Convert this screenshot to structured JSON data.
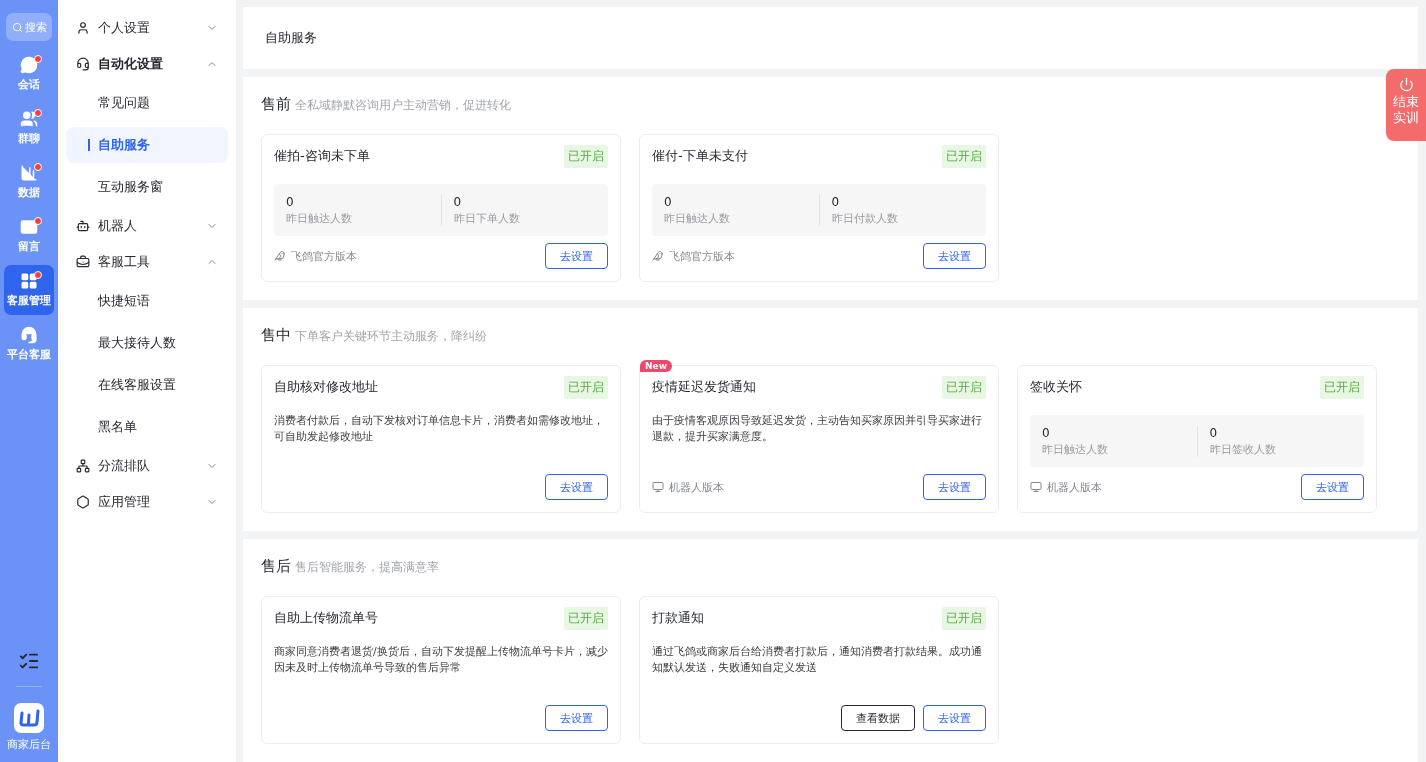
{
  "rail": {
    "search": "搜索",
    "items": [
      {
        "label": "会话",
        "unread": true,
        "selected": false
      },
      {
        "label": "群聊",
        "unread": true,
        "selected": false
      },
      {
        "label": "数据",
        "unread": true,
        "selected": false
      },
      {
        "label": "留言",
        "unread": true,
        "selected": false
      },
      {
        "label": "客服管理",
        "unread": true,
        "selected": true
      },
      {
        "label": "平台客服",
        "unread": false,
        "selected": false
      }
    ],
    "app": "商家后台"
  },
  "menu": [
    {
      "label": "个人设置",
      "expanded": false
    },
    {
      "label": "自动化设置",
      "expanded": true,
      "children": [
        {
          "label": "常见问题",
          "selected": false
        },
        {
          "label": "自助服务",
          "selected": true
        },
        {
          "label": "互动服务窗",
          "selected": false
        }
      ]
    },
    {
      "label": "机器人",
      "expanded": false
    },
    {
      "label": "客服工具",
      "expanded": true,
      "children": [
        {
          "label": "快捷短语",
          "selected": false
        },
        {
          "label": "最大接待人数",
          "selected": false
        },
        {
          "label": "在线客服设置",
          "selected": false
        },
        {
          "label": "黑名单",
          "selected": false
        }
      ]
    },
    {
      "label": "分流排队",
      "expanded": false
    },
    {
      "label": "应用管理",
      "expanded": false
    }
  ],
  "page_title": "自助服务",
  "sections": [
    {
      "title": "售前",
      "subtitle": "全私域静默咨询用户主动营销，促进转化",
      "cards": [
        {
          "title": "催拍-咨询未下单",
          "status": "已开启",
          "stats": [
            {
              "value": "0",
              "label": "昨日触达人数"
            },
            {
              "value": "0",
              "label": "昨日下单人数"
            }
          ],
          "version": {
            "kind": "official",
            "text": "飞鸽官方版本"
          },
          "buttons": [
            {
              "label": "去设置",
              "kind": "primary"
            }
          ]
        },
        {
          "title": "催付-下单未支付",
          "status": "已开启",
          "stats": [
            {
              "value": "0",
              "label": "昨日触达人数"
            },
            {
              "value": "0",
              "label": "昨日付款人数"
            }
          ],
          "version": {
            "kind": "official",
            "text": "飞鸽官方版本"
          },
          "buttons": [
            {
              "label": "去设置",
              "kind": "primary"
            }
          ]
        }
      ]
    },
    {
      "title": "售中",
      "subtitle": "下单客户关键环节主动服务，降纠纷",
      "cards": [
        {
          "title": "自助核对修改地址",
          "status": "已开启",
          "description": "消费者付款后，自动下发核对订单信息卡片，消费者如需修改地址，可自助发起修改地址",
          "buttons": [
            {
              "label": "去设置",
              "kind": "primary"
            }
          ]
        },
        {
          "title": "疫情延迟发货通知",
          "badge": "New",
          "status": "已开启",
          "description": "由于疫情客观原因导致延迟发货，主动告知买家原因并引导买家进行退款，提升买家满意度。",
          "version": {
            "kind": "robot",
            "text": "机器人版本"
          },
          "buttons": [
            {
              "label": "去设置",
              "kind": "primary"
            }
          ]
        },
        {
          "title": "签收关怀",
          "status": "已开启",
          "stats": [
            {
              "value": "0",
              "label": "昨日触达人数"
            },
            {
              "value": "0",
              "label": "昨日签收人数"
            }
          ],
          "version": {
            "kind": "robot",
            "text": "机器人版本"
          },
          "buttons": [
            {
              "label": "去设置",
              "kind": "primary"
            }
          ]
        }
      ]
    },
    {
      "title": "售后",
      "subtitle": "售后智能服务，提高满意率",
      "cards": [
        {
          "title": "自助上传物流单号",
          "status": "已开启",
          "description": "商家同意消费者退货/换货后，自动下发提醒上传物流单号卡片，减少因未及时上传物流单号导致的售后异常",
          "buttons": [
            {
              "label": "去设置",
              "kind": "primary"
            }
          ]
        },
        {
          "title": "打款通知",
          "status": "已开启",
          "description": "通过飞鸽或商家后台给消费者打款后，通知消费者打款结果。成功通知默认发送，失败通知自定义发送",
          "buttons": [
            {
              "label": "查看数据",
              "kind": "secondary"
            },
            {
              "label": "去设置",
              "kind": "primary"
            }
          ]
        }
      ]
    }
  ],
  "end_training": "结束实训"
}
